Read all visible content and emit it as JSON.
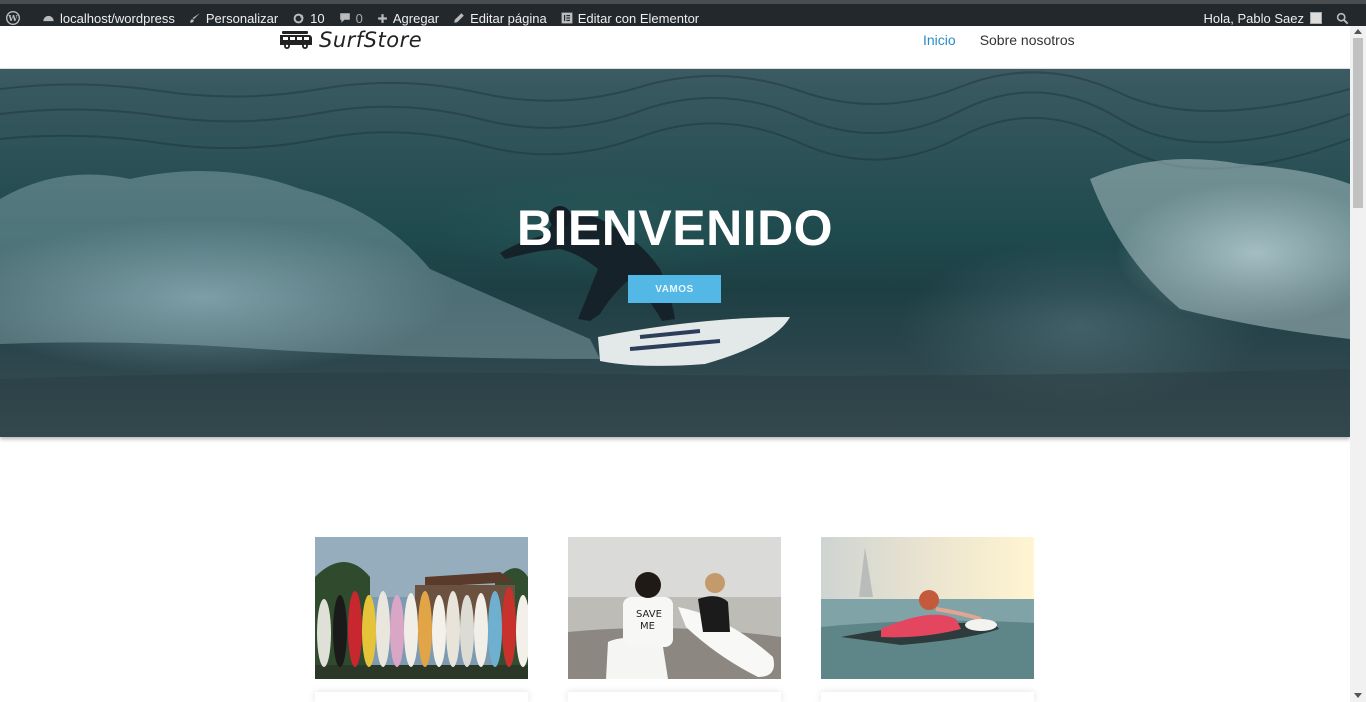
{
  "adminbar": {
    "site": "localhost/wordpress",
    "customize": "Personalizar",
    "updates": "10",
    "comments": "0",
    "add_new": "Agregar",
    "edit_page": "Editar página",
    "edit_elementor": "Editar con Elementor",
    "greeting": "Hola, Pablo Saez"
  },
  "header": {
    "logo_text": "SurfStore",
    "nav": [
      {
        "label": "Inicio",
        "active": true
      },
      {
        "label": "Sobre nosotros",
        "active": false
      }
    ]
  },
  "hero": {
    "title": "BIENVENIDO",
    "button_label": "VAMOS"
  },
  "cards": [
    {
      "image": "surfboards-rack"
    },
    {
      "image": "surfers-on-beach"
    },
    {
      "image": "surfer-paddling-sunset"
    }
  ],
  "colors": {
    "adminbar_bg": "#23282d",
    "nav_active": "#2a8bc9",
    "button_bg": "#54b8e6"
  }
}
